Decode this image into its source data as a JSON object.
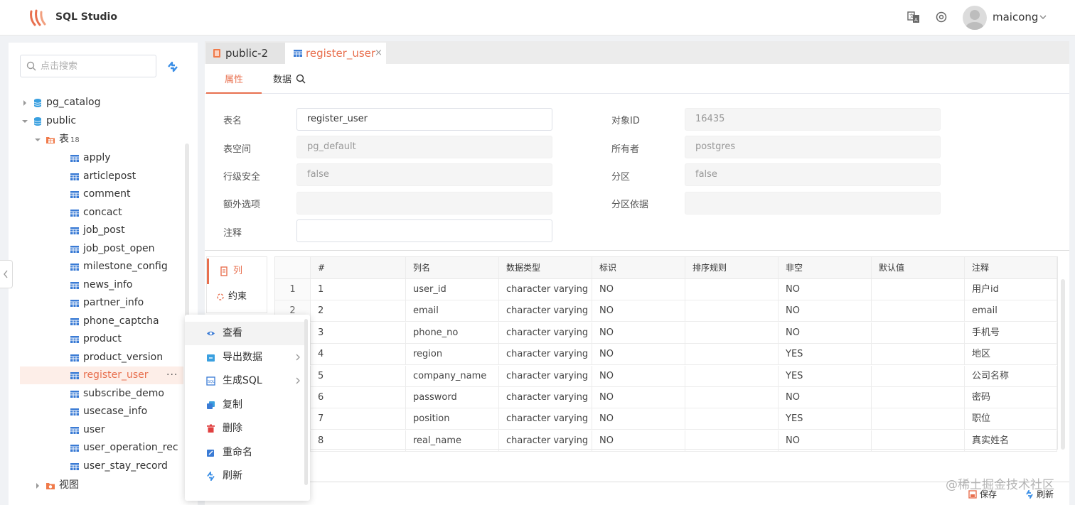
{
  "app": {
    "name": "SQL Studio"
  },
  "user": {
    "name": "maicong"
  },
  "colors": {
    "accent": "#e8704f",
    "table_icon": "#3a7bd5",
    "db_icon": "#3aa0e0",
    "folder_icon": "#f07a4a",
    "danger": "#e04040"
  },
  "sidebar": {
    "search_placeholder": "点击搜索",
    "tree": [
      {
        "label": "pg_catalog",
        "icon": "database-icon"
      },
      {
        "label": "public",
        "icon": "database-icon"
      },
      {
        "label": "表",
        "badge": "18",
        "icon": "folder-table-icon"
      },
      {
        "label": "apply"
      },
      {
        "label": "articlepost"
      },
      {
        "label": "comment"
      },
      {
        "label": "concact"
      },
      {
        "label": "job_post"
      },
      {
        "label": "job_post_open"
      },
      {
        "label": "milestone_config"
      },
      {
        "label": "news_info"
      },
      {
        "label": "partner_info"
      },
      {
        "label": "phone_captcha"
      },
      {
        "label": "product"
      },
      {
        "label": "product_version"
      },
      {
        "label": "register_user",
        "selected": true,
        "more": "···"
      },
      {
        "label": "subscribe_demo"
      },
      {
        "label": "usecase_info"
      },
      {
        "label": "user"
      },
      {
        "label": "user_operation_rec"
      },
      {
        "label": "user_stay_record"
      },
      {
        "label": "视图",
        "icon": "folder-view-icon"
      }
    ]
  },
  "tabs": [
    {
      "label": "public-2",
      "icon": "schema-icon"
    },
    {
      "label": "register_user",
      "icon": "table-icon",
      "active": true,
      "close": "×"
    }
  ],
  "subtabs": [
    {
      "label": "属性",
      "active": true
    },
    {
      "label": "数据"
    }
  ],
  "form": {
    "table_name": {
      "label": "表名",
      "value": "register_user"
    },
    "object_id": {
      "label": "对象ID",
      "value": "16435"
    },
    "tablespace": {
      "label": "表空间",
      "value": "pg_default"
    },
    "owner": {
      "label": "所有者",
      "value": "postgres"
    },
    "row_security": {
      "label": "行级安全",
      "value": "false"
    },
    "partition": {
      "label": "分区",
      "value": "false"
    },
    "extra_options": {
      "label": "额外选项",
      "value": ""
    },
    "partition_basis": {
      "label": "分区依据",
      "value": ""
    },
    "comment": {
      "label": "注释",
      "value": ""
    }
  },
  "side_tabs": [
    {
      "label": "列",
      "active": true
    },
    {
      "label": "约束"
    }
  ],
  "columns_table": {
    "headers": [
      "#",
      "列名",
      "数据类型",
      "标识",
      "排序规则",
      "非空",
      "默认值",
      "注释"
    ],
    "rows": [
      {
        "n": "1",
        "c": [
          "1",
          "user_id",
          "character varying",
          "NO",
          "",
          "NO",
          "",
          "用户id"
        ]
      },
      {
        "n": "2",
        "c": [
          "2",
          "email",
          "character varying",
          "NO",
          "",
          "NO",
          "",
          "email"
        ]
      },
      {
        "n": "",
        "c": [
          "3",
          "phone_no",
          "character varying",
          "NO",
          "",
          "NO",
          "",
          "手机号"
        ]
      },
      {
        "n": "",
        "c": [
          "4",
          "region",
          "character varying",
          "NO",
          "",
          "YES",
          "",
          "地区"
        ]
      },
      {
        "n": "",
        "c": [
          "5",
          "company_name",
          "character varying",
          "NO",
          "",
          "YES",
          "",
          "公司名称"
        ]
      },
      {
        "n": "",
        "c": [
          "6",
          "password",
          "character varying",
          "NO",
          "",
          "NO",
          "",
          "密码"
        ]
      },
      {
        "n": "",
        "c": [
          "7",
          "position",
          "character varying",
          "NO",
          "",
          "YES",
          "",
          "职位"
        ]
      },
      {
        "n": "",
        "c": [
          "8",
          "real_name",
          "character varying",
          "NO",
          "",
          "NO",
          "",
          "真实姓名"
        ]
      }
    ]
  },
  "context_menu": [
    {
      "label": "查看",
      "icon": "eye-icon"
    },
    {
      "label": "导出数据",
      "icon": "export-icon",
      "submenu": true
    },
    {
      "label": "生成SQL",
      "icon": "sql-icon",
      "submenu": true
    },
    {
      "label": "复制",
      "icon": "copy-icon"
    },
    {
      "label": "删除",
      "icon": "trash-icon"
    },
    {
      "label": "重命名",
      "icon": "rename-icon"
    },
    {
      "label": "刷新",
      "icon": "refresh-icon"
    }
  ],
  "bottom": {
    "save": "保存",
    "refresh": "刷新"
  },
  "watermark": "@稀土掘金技术社区"
}
